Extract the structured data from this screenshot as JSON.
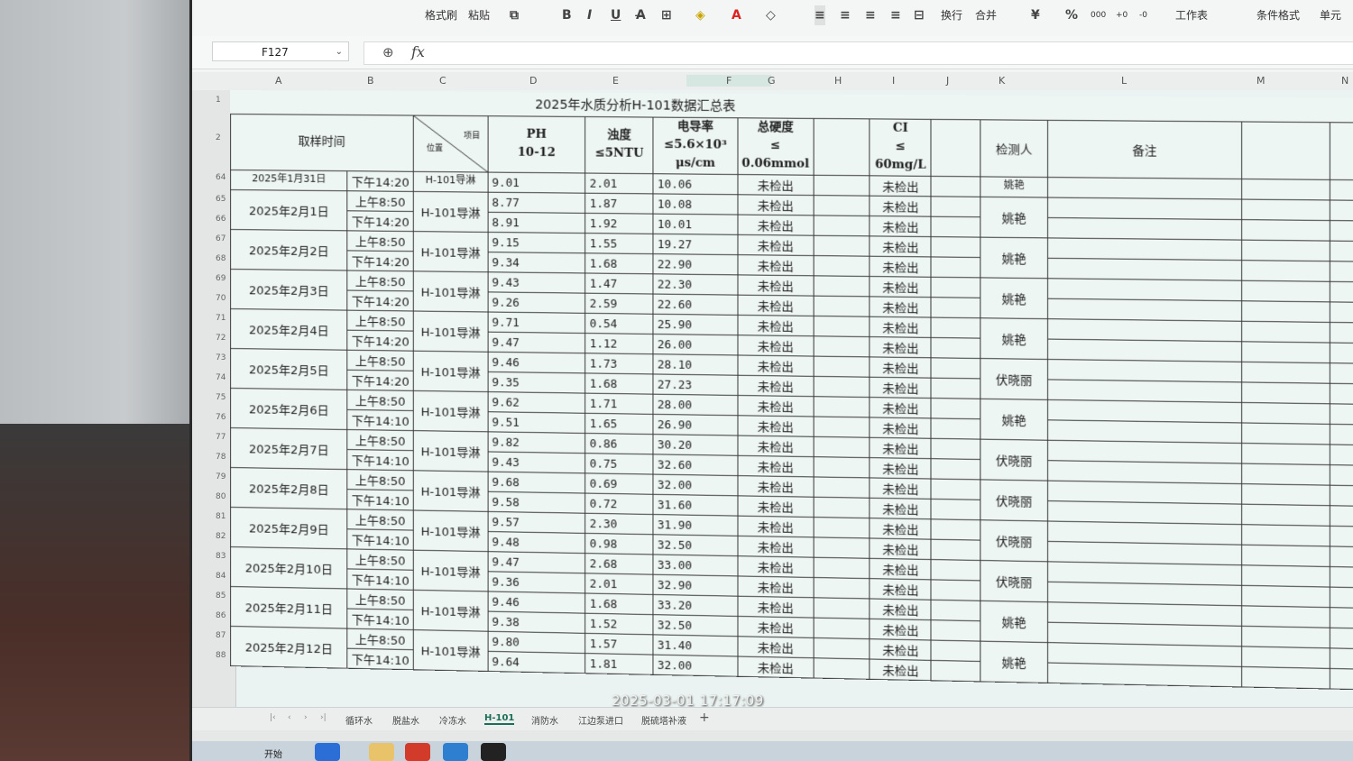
{
  "toolbar": {
    "format_painter": "格式刷",
    "paste": "粘贴",
    "bold": "B",
    "italic": "I",
    "underline": "U",
    "wrap": "换行",
    "merge": "合并",
    "currency": "¥",
    "percent": "%",
    "thousands": "000",
    "worksheet": "工作表",
    "conditional_format": "条件格式",
    "cell": "单元"
  },
  "formula_bar": {
    "cell_ref": "F127",
    "fx": "fx",
    "value": ""
  },
  "columns": [
    "A",
    "B",
    "C",
    "D",
    "E",
    "F",
    "G",
    "H",
    "I",
    "J",
    "K",
    "L",
    "M",
    "N"
  ],
  "sheet": {
    "title": "2025年水质分析H-101数据汇总表",
    "headers": {
      "time": "取样时间",
      "diag_item": "项目",
      "diag_pos": "位置",
      "ph": "PH\n10-12",
      "turbidity": "浊度\n≤5NTU",
      "conductivity": "电导率\n≤5.6×10³\nμs/cm",
      "hardness": "总硬度\n≤\n0.06mmol",
      "cl": "CI\n≤\n60mg/L",
      "inspector": "检测人",
      "remarks": "备注"
    },
    "partial_top": {
      "row": "64",
      "date": "2025年1月31日",
      "time": "下午14:20",
      "position": "H-101导淋",
      "ph": "9.01",
      "turbidity": "2.01",
      "conductivity": "10.06",
      "hardness": "未检出",
      "cl": "未检出",
      "inspector": "姚艳"
    },
    "rows": [
      {
        "date": "2025年2月1日",
        "position": "H-101导淋",
        "inspector": "姚艳",
        "rownums": [
          "65",
          "66"
        ],
        "samples": [
          {
            "time": "上午8:50",
            "ph": "8.77",
            "turbidity": "1.87",
            "conductivity": "10.08",
            "hardness": "未检出",
            "cl": "未检出"
          },
          {
            "time": "下午14:20",
            "ph": "8.91",
            "turbidity": "1.92",
            "conductivity": "10.01",
            "hardness": "未检出",
            "cl": "未检出"
          }
        ]
      },
      {
        "date": "2025年2月2日",
        "position": "H-101导淋",
        "inspector": "姚艳",
        "rownums": [
          "67",
          "68"
        ],
        "samples": [
          {
            "time": "上午8:50",
            "ph": "9.15",
            "turbidity": "1.55",
            "conductivity": "19.27",
            "hardness": "未检出",
            "cl": "未检出"
          },
          {
            "time": "下午14:20",
            "ph": "9.34",
            "turbidity": "1.68",
            "conductivity": "22.90",
            "hardness": "未检出",
            "cl": "未检出"
          }
        ]
      },
      {
        "date": "2025年2月3日",
        "position": "H-101导淋",
        "inspector": "姚艳",
        "rownums": [
          "69",
          "70"
        ],
        "samples": [
          {
            "time": "上午8:50",
            "ph": "9.43",
            "turbidity": "1.47",
            "conductivity": "22.30",
            "hardness": "未检出",
            "cl": "未检出"
          },
          {
            "time": "下午14:20",
            "ph": "9.26",
            "turbidity": "2.59",
            "conductivity": "22.60",
            "hardness": "未检出",
            "cl": "未检出"
          }
        ]
      },
      {
        "date": "2025年2月4日",
        "position": "H-101导淋",
        "inspector": "姚艳",
        "rownums": [
          "71",
          "72"
        ],
        "samples": [
          {
            "time": "上午8:50",
            "ph": "9.71",
            "turbidity": "0.54",
            "conductivity": "25.90",
            "hardness": "未检出",
            "cl": "未检出"
          },
          {
            "time": "下午14:20",
            "ph": "9.47",
            "turbidity": "1.12",
            "conductivity": "26.00",
            "hardness": "未检出",
            "cl": "未检出"
          }
        ]
      },
      {
        "date": "2025年2月5日",
        "position": "H-101导淋",
        "inspector": "伏晓丽",
        "rownums": [
          "73",
          "74"
        ],
        "samples": [
          {
            "time": "上午8:50",
            "ph": "9.46",
            "turbidity": "1.73",
            "conductivity": "28.10",
            "hardness": "未检出",
            "cl": "未检出"
          },
          {
            "time": "下午14:20",
            "ph": "9.35",
            "turbidity": "1.68",
            "conductivity": "27.23",
            "hardness": "未检出",
            "cl": "未检出"
          }
        ]
      },
      {
        "date": "2025年2月6日",
        "position": "H-101导淋",
        "inspector": "姚艳",
        "rownums": [
          "75",
          "76"
        ],
        "samples": [
          {
            "time": "上午8:50",
            "ph": "9.62",
            "turbidity": "1.71",
            "conductivity": "28.00",
            "hardness": "未检出",
            "cl": "未检出"
          },
          {
            "time": "下午14:10",
            "ph": "9.51",
            "turbidity": "1.65",
            "conductivity": "26.90",
            "hardness": "未检出",
            "cl": "未检出"
          }
        ]
      },
      {
        "date": "2025年2月7日",
        "position": "H-101导淋",
        "inspector": "伏晓丽",
        "rownums": [
          "77",
          "78"
        ],
        "samples": [
          {
            "time": "上午8:50",
            "ph": "9.82",
            "turbidity": "0.86",
            "conductivity": "30.20",
            "hardness": "未检出",
            "cl": "未检出"
          },
          {
            "time": "下午14:10",
            "ph": "9.43",
            "turbidity": "0.75",
            "conductivity": "32.60",
            "hardness": "未检出",
            "cl": "未检出"
          }
        ]
      },
      {
        "date": "2025年2月8日",
        "position": "H-101导淋",
        "inspector": "伏晓丽",
        "rownums": [
          "79",
          "80"
        ],
        "samples": [
          {
            "time": "上午8:50",
            "ph": "9.68",
            "turbidity": "0.69",
            "conductivity": "32.00",
            "hardness": "未检出",
            "cl": "未检出"
          },
          {
            "time": "下午14:10",
            "ph": "9.58",
            "turbidity": "0.72",
            "conductivity": "31.60",
            "hardness": "未检出",
            "cl": "未检出"
          }
        ]
      },
      {
        "date": "2025年2月9日",
        "position": "H-101导淋",
        "inspector": "伏晓丽",
        "rownums": [
          "81",
          "82"
        ],
        "samples": [
          {
            "time": "上午8:50",
            "ph": "9.57",
            "turbidity": "2.30",
            "conductivity": "31.90",
            "hardness": "未检出",
            "cl": "未检出"
          },
          {
            "time": "下午14:10",
            "ph": "9.48",
            "turbidity": "0.98",
            "conductivity": "32.50",
            "hardness": "未检出",
            "cl": "未检出"
          }
        ]
      },
      {
        "date": "2025年2月10日",
        "position": "H-101导淋",
        "inspector": "伏晓丽",
        "rownums": [
          "83",
          "84"
        ],
        "samples": [
          {
            "time": "上午8:50",
            "ph": "9.47",
            "turbidity": "2.68",
            "conductivity": "33.00",
            "hardness": "未检出",
            "cl": "未检出"
          },
          {
            "time": "下午14:10",
            "ph": "9.36",
            "turbidity": "2.01",
            "conductivity": "32.90",
            "hardness": "未检出",
            "cl": "未检出"
          }
        ]
      },
      {
        "date": "2025年2月11日",
        "position": "H-101导淋",
        "inspector": "姚艳",
        "rownums": [
          "85",
          "86"
        ],
        "samples": [
          {
            "time": "上午8:50",
            "ph": "9.46",
            "turbidity": "1.68",
            "conductivity": "33.20",
            "hardness": "未检出",
            "cl": "未检出"
          },
          {
            "time": "下午14:10",
            "ph": "9.38",
            "turbidity": "1.52",
            "conductivity": "32.50",
            "hardness": "未检出",
            "cl": "未检出"
          }
        ]
      },
      {
        "date": "2025年2月12日",
        "position": "H-101导淋",
        "inspector": "姚艳",
        "rownums": [
          "87",
          "88"
        ],
        "samples": [
          {
            "time": "上午8:50",
            "ph": "9.80",
            "turbidity": "1.57",
            "conductivity": "31.40",
            "hardness": "未检出",
            "cl": "未检出"
          },
          {
            "time": "下午14:10",
            "ph": "9.64",
            "turbidity": "1.81",
            "conductivity": "32.00",
            "hardness": "未检出",
            "cl": "未检出"
          }
        ]
      }
    ],
    "header_rownums": [
      "1",
      "2"
    ]
  },
  "sheet_tabs": [
    "循环水",
    "脱盐水",
    "冷冻水",
    "H-101",
    "消防水",
    "江边泵进口",
    "脱硫塔补液"
  ],
  "active_tab": "H-101",
  "timestamp": "2025-03-01 17:17:09",
  "taskbar": {
    "start": "开始"
  }
}
